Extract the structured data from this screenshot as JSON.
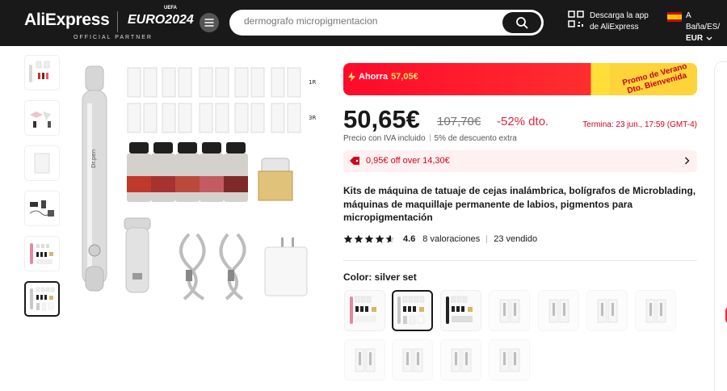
{
  "header": {
    "logo": "AliExpress",
    "partner": "OFFICIAL PARTNER",
    "euro": "EURO2024",
    "euro_top": "UEFA",
    "search_value": "dermografo micropigmentacion",
    "app_line1": "Descarga la app",
    "app_line2": "de AliExpress",
    "region_line1": "A Baña/ES/",
    "region_line2": "EUR"
  },
  "promo": {
    "label": "Ahorra",
    "amount": "57,05€",
    "badge": "Promo de Verano Dto. Bienvenida"
  },
  "price": {
    "current": "50,65€",
    "original": "107,70€",
    "discount": "-52% dto.",
    "ends": "Termina: 23 jun., 17:59 (GMT-4)",
    "tax": "Precio con IVA incluido",
    "extra": "5% de descuento extra"
  },
  "coupon": {
    "text": "0,95€ off over 14,30€"
  },
  "product": {
    "title": "Kits de máquina de tatuaje de cejas inalámbrica, bolígrafos de Microblading, máquinas de maquillaje permanente de labios, pigmentos para micropigmentación",
    "rating": "4.6",
    "reviews": "8 valoraciones",
    "sold": "23 vendido",
    "color_label": "Color: silver set"
  },
  "image_labels": {
    "row1": "1R",
    "row2": "3R",
    "pen_text": "Dr.pen"
  },
  "colors": {
    "accent": "#e4273a",
    "header_bg": "#191919",
    "promo_yellow": "#ffd43b"
  }
}
